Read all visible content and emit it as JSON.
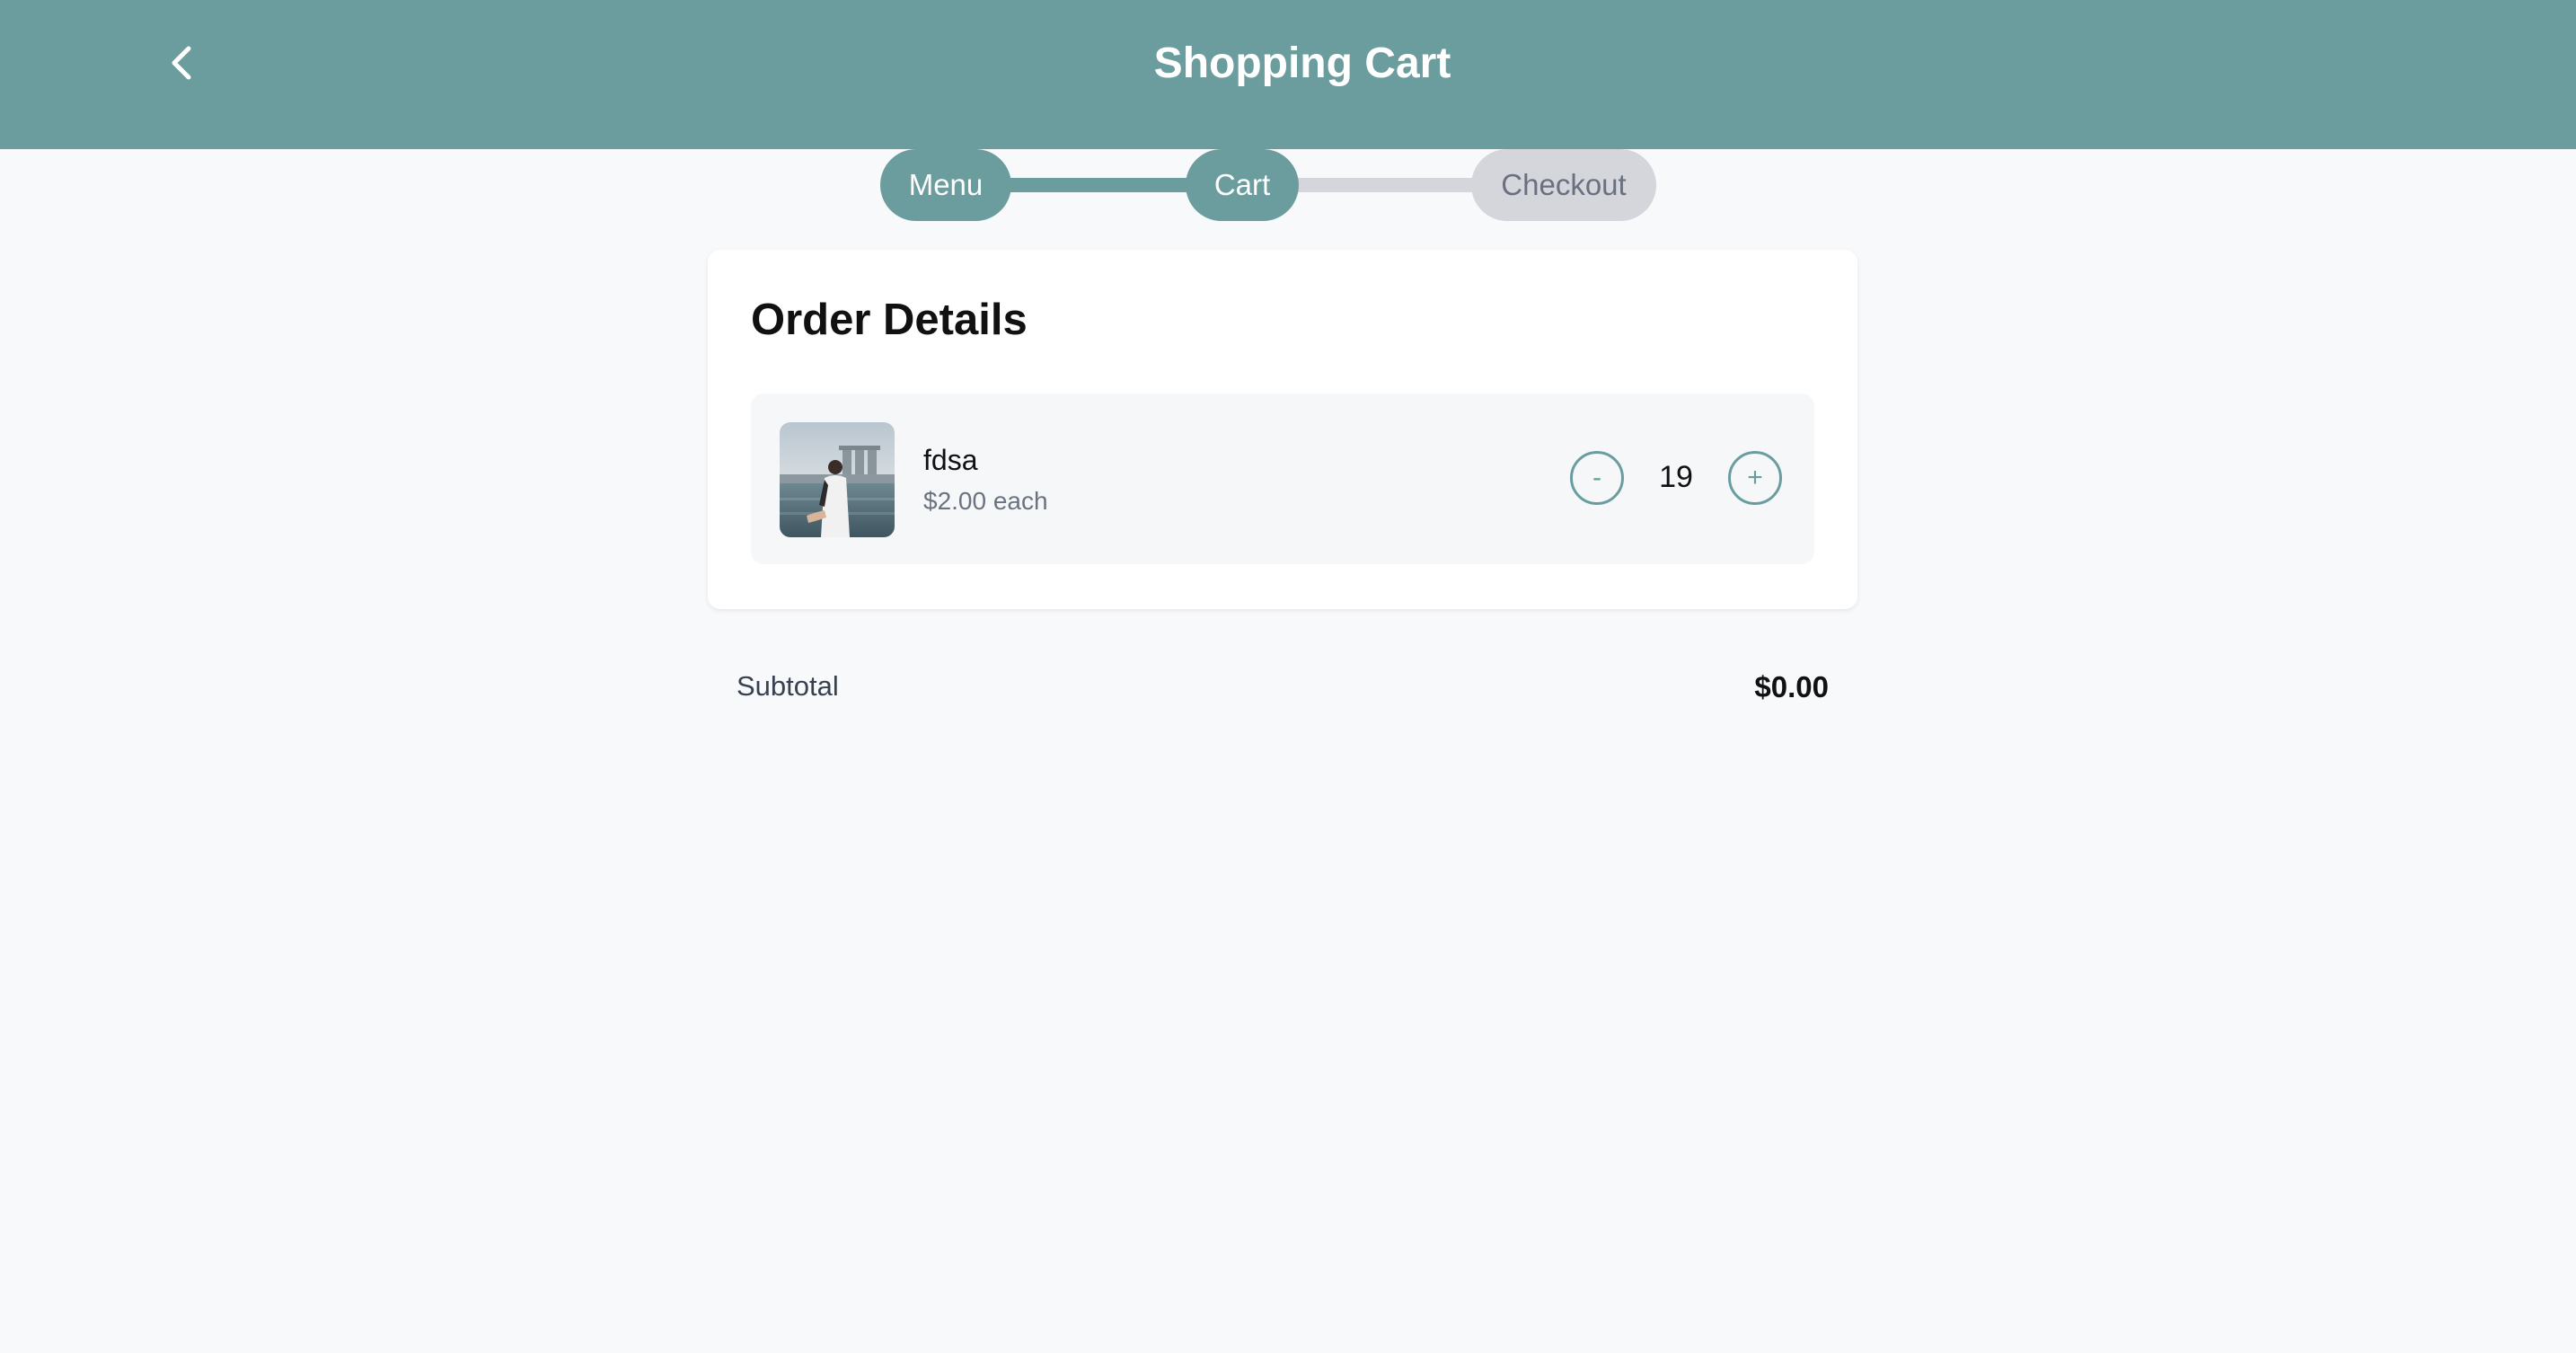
{
  "header": {
    "title": "Shopping Cart",
    "back_icon": "chevron-left-icon",
    "color": "#6b9d9e"
  },
  "stepper": {
    "steps": [
      {
        "label": "Menu",
        "state": "complete"
      },
      {
        "label": "Cart",
        "state": "current"
      },
      {
        "label": "Checkout",
        "state": "upcoming"
      }
    ]
  },
  "order": {
    "title": "Order Details",
    "items": [
      {
        "name": "fdsa",
        "price": "$2.00 each",
        "quantity": "19",
        "minus_label": "-",
        "plus_label": "+"
      }
    ]
  },
  "summary": {
    "subtotal_label": "Subtotal",
    "subtotal_value": "$0.00"
  }
}
